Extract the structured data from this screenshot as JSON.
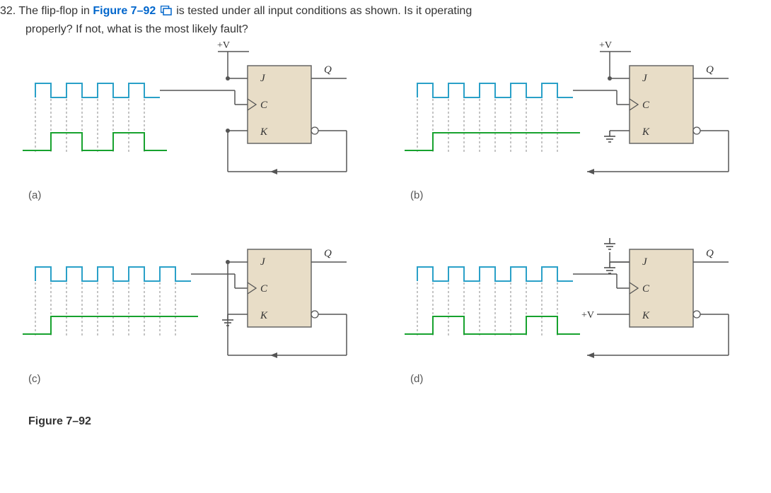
{
  "question": {
    "number": "32.",
    "text_before_ref": "The flip-flop in ",
    "fig_ref": "Figure 7–92",
    "text_after_ref": " is tested under all input conditions as shown. Is it operating",
    "line2": "properly? If not, what is the most likely fault?"
  },
  "diagram": {
    "pins": {
      "J": "J",
      "C": "C",
      "K": "K"
    },
    "out_label": "Q",
    "hi_rail": "+V"
  },
  "parts": {
    "a": {
      "label": "(a)",
      "j_src": "hi",
      "k_src": "fb",
      "clock_len": 4,
      "q_pattern": "toggle4"
    },
    "b": {
      "label": "(b)",
      "j_src": "hi",
      "k_src": "gnd",
      "clock_len": 5,
      "q_pattern": "step"
    },
    "c": {
      "label": "(c)",
      "j_src": "fb",
      "k_src": "gnd",
      "clock_len": 5,
      "q_pattern": "step"
    },
    "d": {
      "label": "(d)",
      "j_src": "gnd",
      "k_src": "hi",
      "clock_len": 5,
      "q_pattern": "toggle3"
    }
  },
  "figure_caption": "Figure 7–92"
}
